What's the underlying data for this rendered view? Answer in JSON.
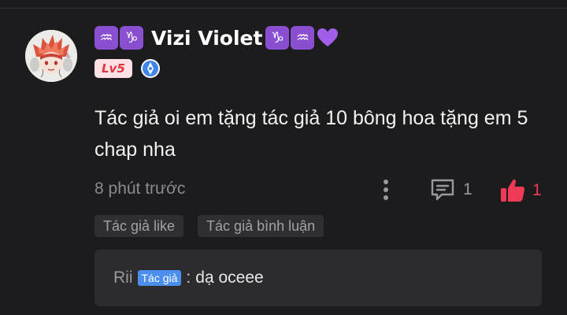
{
  "comment": {
    "user": {
      "zodiac_left": [
        "♒",
        "♑"
      ],
      "name": "Vizi Violet",
      "zodiac_right": [
        "♑",
        "♒"
      ],
      "heart_icon": "purple-heart-icon",
      "level": "Lv5",
      "badge_icon": "blue-pen-badge-icon"
    },
    "text": "Tác giả oi em tặng tác giả 10 bông hoa tặng em 5 chap nha",
    "time": "8 phút trước",
    "reply_count": "1",
    "like_count": "1",
    "tags": [
      "Tác giả like",
      "Tác giả bình luận"
    ],
    "reply": {
      "author": "Rii",
      "author_badge": "Tác giả",
      "separator": ":",
      "content": "dạ oceee"
    }
  },
  "colors": {
    "background": "#1c1c1e",
    "zodiac": "#8a4fd1",
    "heart": "#a15ee8",
    "level_text": "#e0353f",
    "level_bg": "#ffe1e5",
    "like": "#ee3a54",
    "author_badge": "#4b8ef0",
    "reply_bg": "#2c2c2f"
  }
}
